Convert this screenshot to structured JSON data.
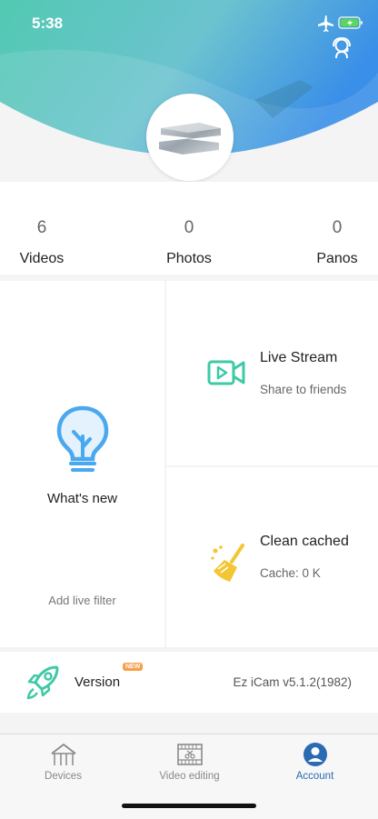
{
  "status_bar": {
    "time": "5:38"
  },
  "stats": [
    {
      "count": "6",
      "label": "Videos"
    },
    {
      "count": "0",
      "label": "Photos"
    },
    {
      "count": "0",
      "label": "Panos"
    }
  ],
  "whats_new": {
    "title": "What's new",
    "subtitle": "Add live filter"
  },
  "live_stream": {
    "title": "Live Stream",
    "subtitle": "Share to friends"
  },
  "clean_cached": {
    "title": "Clean cached",
    "subtitle": "Cache: 0 K"
  },
  "version": {
    "label": "Version",
    "badge": "NEW",
    "value": "Ez iCam v5.1.2(1982)"
  },
  "tabs": [
    {
      "label": "Devices",
      "icon": "house-icon",
      "active": false
    },
    {
      "label": "Video editing",
      "icon": "film-scissors-icon",
      "active": false
    },
    {
      "label": "Account",
      "icon": "person-icon",
      "active": true
    }
  ],
  "colors": {
    "header_left": "#4fc7b4",
    "header_right": "#3d93e6",
    "accent_green": "#3ec9a7",
    "accent_blue": "#4aa8ee",
    "accent_yellow": "#f4c633",
    "tab_active": "#2b6bb3",
    "badge_orange": "#f5a04a"
  }
}
